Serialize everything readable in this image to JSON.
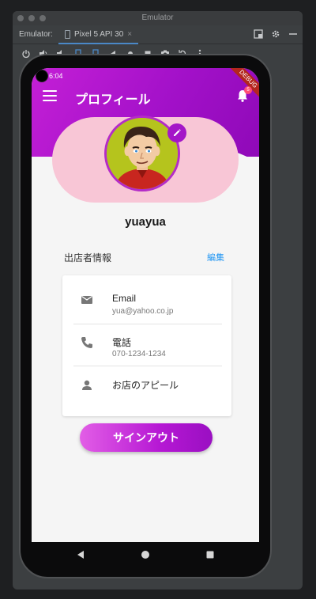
{
  "window": {
    "title": "Emulator"
  },
  "tabbar": {
    "label": "Emulator:",
    "tab_name": "Pixel 5 API 30",
    "close": "×"
  },
  "status": {
    "time": "6:04"
  },
  "app": {
    "title": "プロフィール",
    "notification_count": "5",
    "debug_banner": "DEBUG",
    "username": "yuayua",
    "section_title": "出店者情報",
    "edit_label": "編集",
    "info_rows": [
      {
        "label": "Email",
        "value": "yua@yahoo.co.jp",
        "icon": "mail-icon"
      },
      {
        "label": "電話",
        "value": "070-1234-1234",
        "icon": "phone-icon"
      },
      {
        "label": "お店のアピール",
        "value": "",
        "icon": "person-icon"
      }
    ],
    "signout_label": "サインアウト"
  },
  "colors": {
    "accent": "#a311c9",
    "pill": "#f8c6d6",
    "link": "#2196f3"
  }
}
